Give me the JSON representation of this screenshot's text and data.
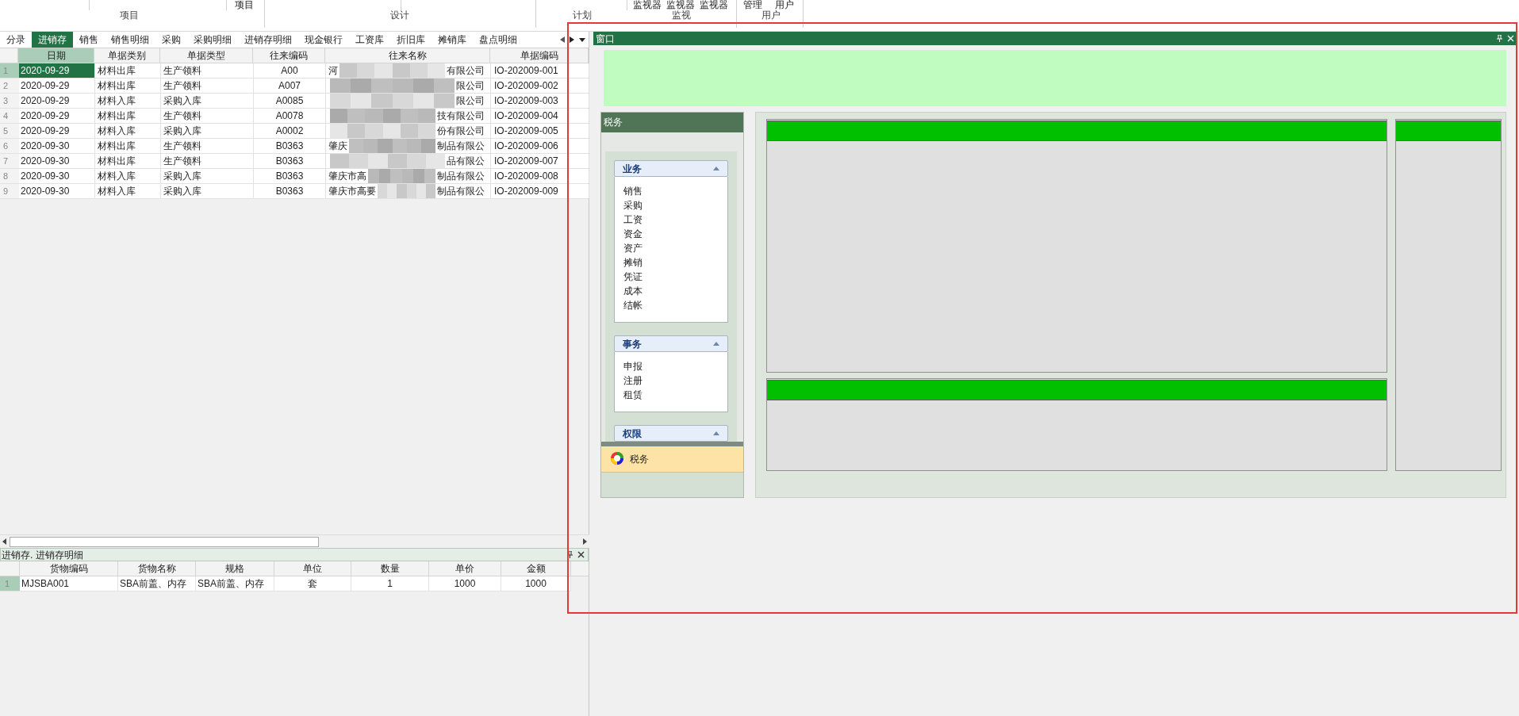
{
  "ribbon": {
    "top_items": [
      {
        "label": "项目"
      },
      {
        "label": "监视器"
      },
      {
        "label": "监视器"
      },
      {
        "label": "监视器"
      },
      {
        "label": "管理"
      },
      {
        "label": "用户"
      }
    ],
    "groups": [
      {
        "label": "项目"
      },
      {
        "label": "设计"
      },
      {
        "label": "计划"
      },
      {
        "label": "监视"
      },
      {
        "label": "用户"
      }
    ]
  },
  "tabs": [
    {
      "label": "分录",
      "selected": false
    },
    {
      "label": "进销存",
      "selected": true
    },
    {
      "label": "销售",
      "selected": false
    },
    {
      "label": "销售明细",
      "selected": false
    },
    {
      "label": "采购",
      "selected": false
    },
    {
      "label": "采购明细",
      "selected": false
    },
    {
      "label": "进销存明细",
      "selected": false
    },
    {
      "label": "现金银行",
      "selected": false
    },
    {
      "label": "工资库",
      "selected": false
    },
    {
      "label": "折旧库",
      "selected": false
    },
    {
      "label": "摊销库",
      "selected": false
    },
    {
      "label": "盘点明细",
      "selected": false
    }
  ],
  "main_table": {
    "columns": [
      "日期",
      "单据类别",
      "单据类型",
      "往来编码",
      "往来名称",
      "单据编码"
    ],
    "rows": [
      {
        "num": "1",
        "selected": true,
        "cells": [
          "2020-09-29",
          "材料出库",
          "生产领料",
          "A00",
          [
            "河",
            "有限公司"
          ],
          "IO-202009-001"
        ]
      },
      {
        "num": "2",
        "selected": false,
        "cells": [
          "2020-09-29",
          "材料出库",
          "生产领料",
          "A007",
          [
            "",
            "限公司"
          ],
          "IO-202009-002"
        ]
      },
      {
        "num": "3",
        "selected": false,
        "cells": [
          "2020-09-29",
          "材料入库",
          "采购入库",
          "A0085",
          [
            "",
            "限公司"
          ],
          "IO-202009-003"
        ]
      },
      {
        "num": "4",
        "selected": false,
        "cells": [
          "2020-09-29",
          "材料出库",
          "生产领料",
          "A0078",
          [
            "",
            "技有限公司"
          ],
          "IO-202009-004"
        ]
      },
      {
        "num": "5",
        "selected": false,
        "cells": [
          "2020-09-29",
          "材料入库",
          "采购入库",
          "A0002",
          [
            "",
            "份有限公司"
          ],
          "IO-202009-005"
        ]
      },
      {
        "num": "6",
        "selected": false,
        "cells": [
          "2020-09-30",
          "材料出库",
          "生产领料",
          "B0363",
          [
            "肇庆",
            "制品有限公"
          ],
          "IO-202009-006"
        ]
      },
      {
        "num": "7",
        "selected": false,
        "cells": [
          "2020-09-30",
          "材料出库",
          "生产领料",
          "B0363",
          [
            "",
            "品有限公"
          ],
          "IO-202009-007"
        ]
      },
      {
        "num": "8",
        "selected": false,
        "cells": [
          "2020-09-30",
          "材料入库",
          "采购入库",
          "B0363",
          [
            "肇庆市高",
            "制品有限公"
          ],
          "IO-202009-008"
        ]
      },
      {
        "num": "9",
        "selected": false,
        "cells": [
          "2020-09-30",
          "材料入库",
          "采购入库",
          "B0363",
          [
            "肇庆市高要",
            "制品有限公"
          ],
          "IO-202009-009"
        ]
      }
    ]
  },
  "detail_panel": {
    "title": "进销存. 进销存明细",
    "columns": [
      "货物编码",
      "货物名称",
      "规格",
      "单位",
      "数量",
      "单价",
      "金额"
    ],
    "rows": [
      {
        "num": "1",
        "cells": [
          "MJSBA001",
          "SBA前盖、内存",
          "SBA前盖、内存",
          "套",
          "1",
          "1000",
          "1000"
        ]
      }
    ]
  },
  "window_panel": {
    "title": "窗口",
    "nav": {
      "title": "税务",
      "groups": [
        {
          "title": "业务",
          "expanded": true,
          "items": [
            "销售",
            "采购",
            "工资",
            "资金",
            "资产",
            "摊销",
            "凭证",
            "成本",
            "结帐"
          ]
        },
        {
          "title": "事务",
          "expanded": true,
          "items": [
            "申报",
            "注册",
            "租赁"
          ]
        },
        {
          "title": "权限",
          "expanded": true
        }
      ],
      "footer": "税务"
    }
  }
}
